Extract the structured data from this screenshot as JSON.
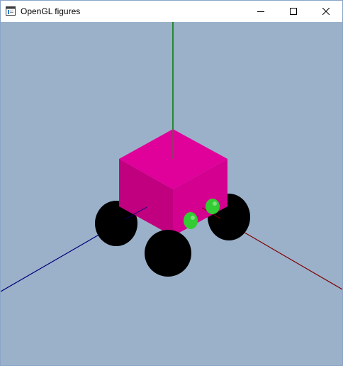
{
  "window": {
    "title": "OpenGL figures",
    "controls": {
      "minimize": "minimize-icon",
      "maximize": "maximize-icon",
      "close": "close-icon"
    }
  },
  "scene": {
    "background_color": "#9bb1ca",
    "cube_color": "#e0009a",
    "wheel_color": "#000000",
    "light_color": "#33cc33",
    "axis_colors": {
      "y": "#007a00",
      "x": "#800000",
      "z": "#00007a"
    }
  }
}
